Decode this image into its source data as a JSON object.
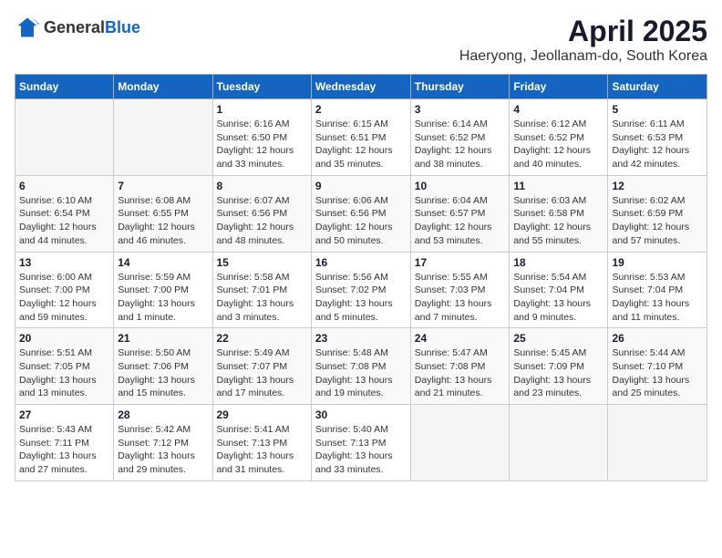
{
  "header": {
    "logo_general": "General",
    "logo_blue": "Blue",
    "month_title": "April 2025",
    "location": "Haeryong, Jeollanam-do, South Korea"
  },
  "days_of_week": [
    "Sunday",
    "Monday",
    "Tuesday",
    "Wednesday",
    "Thursday",
    "Friday",
    "Saturday"
  ],
  "weeks": [
    [
      {
        "day": "",
        "info": ""
      },
      {
        "day": "",
        "info": ""
      },
      {
        "day": "1",
        "sunrise": "6:16 AM",
        "sunset": "6:50 PM",
        "daylight": "12 hours and 33 minutes."
      },
      {
        "day": "2",
        "sunrise": "6:15 AM",
        "sunset": "6:51 PM",
        "daylight": "12 hours and 35 minutes."
      },
      {
        "day": "3",
        "sunrise": "6:14 AM",
        "sunset": "6:52 PM",
        "daylight": "12 hours and 38 minutes."
      },
      {
        "day": "4",
        "sunrise": "6:12 AM",
        "sunset": "6:52 PM",
        "daylight": "12 hours and 40 minutes."
      },
      {
        "day": "5",
        "sunrise": "6:11 AM",
        "sunset": "6:53 PM",
        "daylight": "12 hours and 42 minutes."
      }
    ],
    [
      {
        "day": "6",
        "sunrise": "6:10 AM",
        "sunset": "6:54 PM",
        "daylight": "12 hours and 44 minutes."
      },
      {
        "day": "7",
        "sunrise": "6:08 AM",
        "sunset": "6:55 PM",
        "daylight": "12 hours and 46 minutes."
      },
      {
        "day": "8",
        "sunrise": "6:07 AM",
        "sunset": "6:56 PM",
        "daylight": "12 hours and 48 minutes."
      },
      {
        "day": "9",
        "sunrise": "6:06 AM",
        "sunset": "6:56 PM",
        "daylight": "12 hours and 50 minutes."
      },
      {
        "day": "10",
        "sunrise": "6:04 AM",
        "sunset": "6:57 PM",
        "daylight": "12 hours and 53 minutes."
      },
      {
        "day": "11",
        "sunrise": "6:03 AM",
        "sunset": "6:58 PM",
        "daylight": "12 hours and 55 minutes."
      },
      {
        "day": "12",
        "sunrise": "6:02 AM",
        "sunset": "6:59 PM",
        "daylight": "12 hours and 57 minutes."
      }
    ],
    [
      {
        "day": "13",
        "sunrise": "6:00 AM",
        "sunset": "7:00 PM",
        "daylight": "12 hours and 59 minutes."
      },
      {
        "day": "14",
        "sunrise": "5:59 AM",
        "sunset": "7:00 PM",
        "daylight": "13 hours and 1 minute."
      },
      {
        "day": "15",
        "sunrise": "5:58 AM",
        "sunset": "7:01 PM",
        "daylight": "13 hours and 3 minutes."
      },
      {
        "day": "16",
        "sunrise": "5:56 AM",
        "sunset": "7:02 PM",
        "daylight": "13 hours and 5 minutes."
      },
      {
        "day": "17",
        "sunrise": "5:55 AM",
        "sunset": "7:03 PM",
        "daylight": "13 hours and 7 minutes."
      },
      {
        "day": "18",
        "sunrise": "5:54 AM",
        "sunset": "7:04 PM",
        "daylight": "13 hours and 9 minutes."
      },
      {
        "day": "19",
        "sunrise": "5:53 AM",
        "sunset": "7:04 PM",
        "daylight": "13 hours and 11 minutes."
      }
    ],
    [
      {
        "day": "20",
        "sunrise": "5:51 AM",
        "sunset": "7:05 PM",
        "daylight": "13 hours and 13 minutes."
      },
      {
        "day": "21",
        "sunrise": "5:50 AM",
        "sunset": "7:06 PM",
        "daylight": "13 hours and 15 minutes."
      },
      {
        "day": "22",
        "sunrise": "5:49 AM",
        "sunset": "7:07 PM",
        "daylight": "13 hours and 17 minutes."
      },
      {
        "day": "23",
        "sunrise": "5:48 AM",
        "sunset": "7:08 PM",
        "daylight": "13 hours and 19 minutes."
      },
      {
        "day": "24",
        "sunrise": "5:47 AM",
        "sunset": "7:08 PM",
        "daylight": "13 hours and 21 minutes."
      },
      {
        "day": "25",
        "sunrise": "5:45 AM",
        "sunset": "7:09 PM",
        "daylight": "13 hours and 23 minutes."
      },
      {
        "day": "26",
        "sunrise": "5:44 AM",
        "sunset": "7:10 PM",
        "daylight": "13 hours and 25 minutes."
      }
    ],
    [
      {
        "day": "27",
        "sunrise": "5:43 AM",
        "sunset": "7:11 PM",
        "daylight": "13 hours and 27 minutes."
      },
      {
        "day": "28",
        "sunrise": "5:42 AM",
        "sunset": "7:12 PM",
        "daylight": "13 hours and 29 minutes."
      },
      {
        "day": "29",
        "sunrise": "5:41 AM",
        "sunset": "7:13 PM",
        "daylight": "13 hours and 31 minutes."
      },
      {
        "day": "30",
        "sunrise": "5:40 AM",
        "sunset": "7:13 PM",
        "daylight": "13 hours and 33 minutes."
      },
      {
        "day": "",
        "info": ""
      },
      {
        "day": "",
        "info": ""
      },
      {
        "day": "",
        "info": ""
      }
    ]
  ],
  "labels": {
    "sunrise_prefix": "Sunrise: ",
    "sunset_prefix": "Sunset: ",
    "daylight_prefix": "Daylight: "
  }
}
